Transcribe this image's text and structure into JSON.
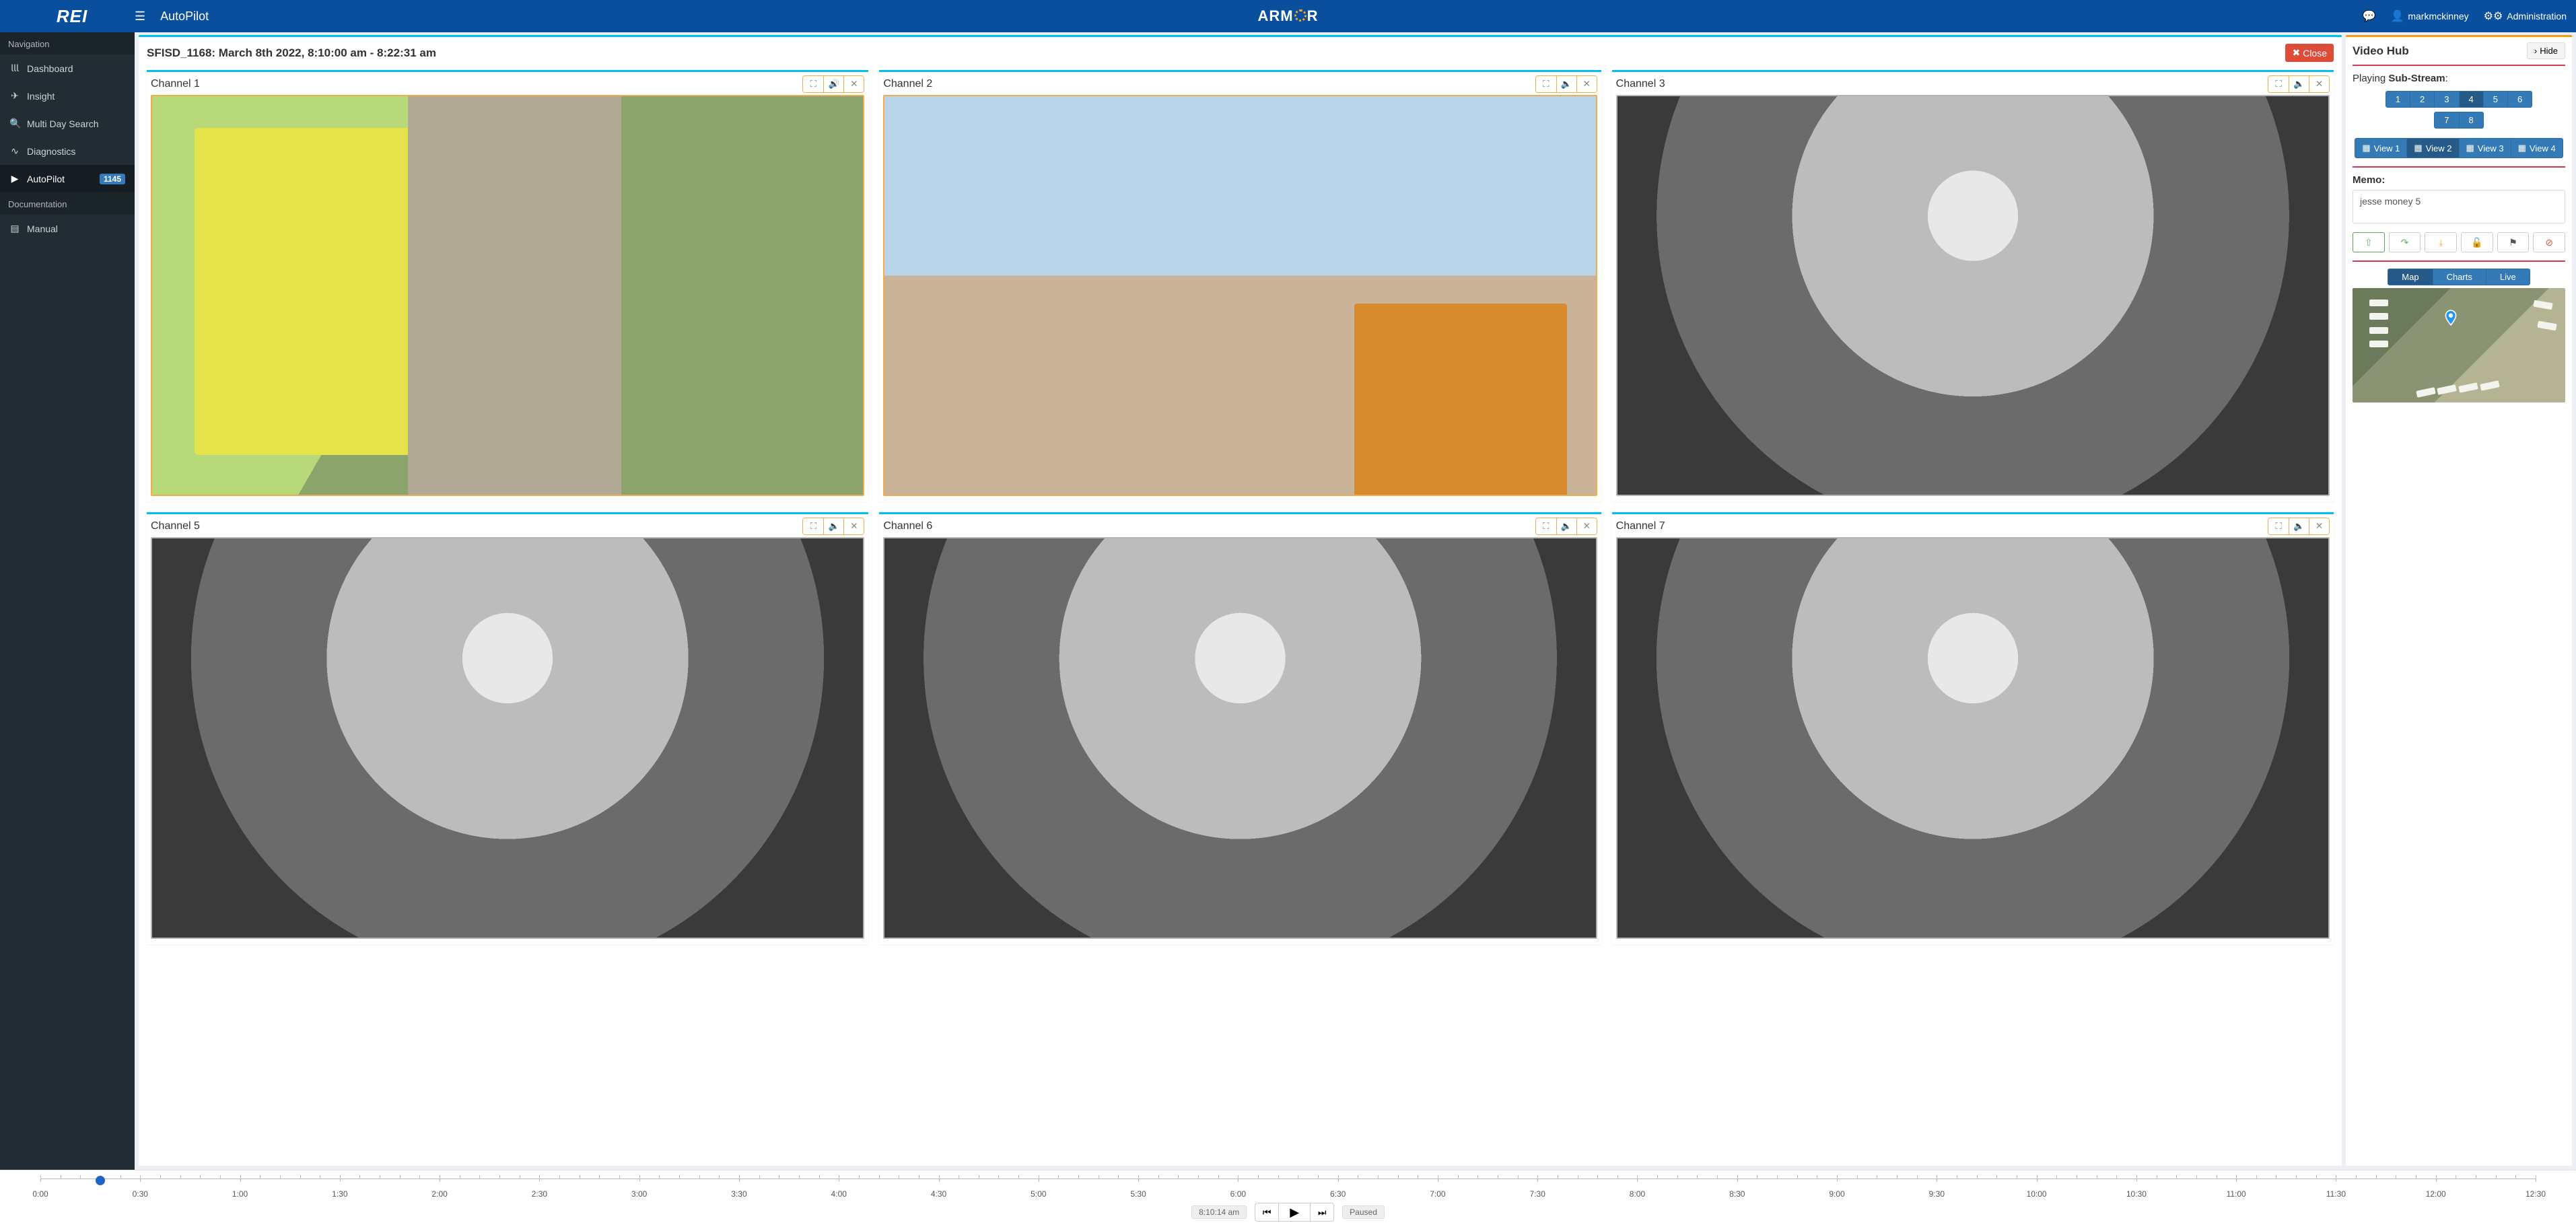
{
  "brand": "REI",
  "center_brand_pre": "ARM",
  "center_brand_post": "R",
  "app_title": "AutoPilot",
  "top_right": {
    "username": "markmckinney",
    "admin": "Administration"
  },
  "sidebar": {
    "section_nav": "Navigation",
    "section_doc": "Documentation",
    "items": [
      {
        "label": "Dashboard",
        "icon": "chart"
      },
      {
        "label": "Insight",
        "icon": "map"
      },
      {
        "label": "Multi Day Search",
        "icon": "search"
      },
      {
        "label": "Diagnostics",
        "icon": "pulse"
      },
      {
        "label": "AutoPilot",
        "icon": "play",
        "badge": "1145",
        "active": true
      }
    ],
    "doc_items": [
      {
        "label": "Manual",
        "icon": "book"
      }
    ]
  },
  "page": {
    "title": "SFISD_1168: March 8th 2022, 8:10:00 am - 8:22:31 am",
    "close": "Close"
  },
  "channels": [
    {
      "label": "Channel 1",
      "style": "color1",
      "sound": true
    },
    {
      "label": "Channel 2",
      "style": "color2"
    },
    {
      "label": "Channel 3",
      "style": "bw"
    },
    {
      "label": "Channel 5",
      "style": "bw"
    },
    {
      "label": "Channel 6",
      "style": "bw"
    },
    {
      "label": "Channel 7",
      "style": "bw"
    }
  ],
  "hub": {
    "title": "Video Hub",
    "hide": "Hide",
    "playing_pre": "Playing ",
    "playing_bold": "Sub-Stream",
    "playing_post": ":",
    "streams": [
      "1",
      "2",
      "3",
      "4",
      "5",
      "6",
      "7",
      "8"
    ],
    "active_stream": "4",
    "views": [
      "View 1",
      "View 2",
      "View 3",
      "View 4"
    ],
    "active_view": "View 2"
  },
  "memo": {
    "label": "Memo:",
    "value": "jesse money 5"
  },
  "tabs": {
    "items": [
      "Map",
      "Charts",
      "Live"
    ],
    "active": "Map"
  },
  "timeline": {
    "labels": [
      "0:00",
      "0:30",
      "1:00",
      "1:30",
      "2:00",
      "2:30",
      "3:00",
      "3:30",
      "4:00",
      "4:30",
      "5:00",
      "5:30",
      "6:00",
      "6:30",
      "7:00",
      "7:30",
      "8:00",
      "8:30",
      "9:00",
      "9:30",
      "10:00",
      "10:30",
      "11:00",
      "11:30",
      "12:00",
      "12:30"
    ],
    "current": "8:10:14 am",
    "status": "Paused"
  }
}
